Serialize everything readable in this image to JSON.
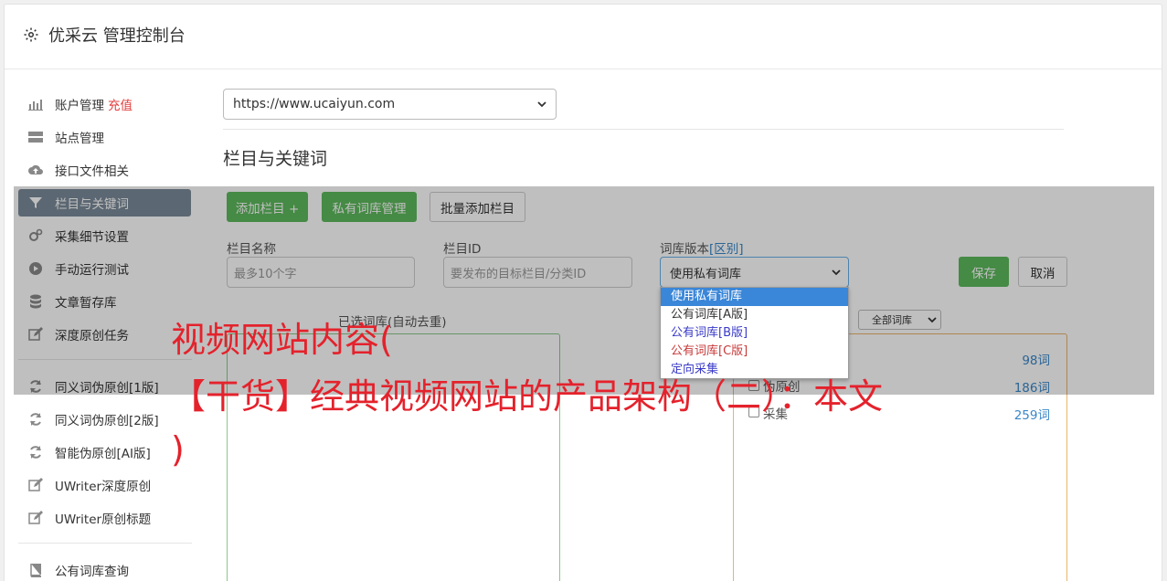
{
  "header": {
    "title": "优采云 管理控制台"
  },
  "sidebar": {
    "items": [
      {
        "label": "账户管理",
        "badge": "充值",
        "icon": "bar-chart-icon"
      },
      {
        "label": "站点管理",
        "icon": "server-icon"
      },
      {
        "label": "接口文件相关",
        "icon": "cloud-upload-icon"
      },
      {
        "label": "栏目与关键词",
        "icon": "filter-icon"
      },
      {
        "label": "采集细节设置",
        "icon": "gears-icon"
      },
      {
        "label": "手动运行测试",
        "icon": "play-circle-icon"
      },
      {
        "label": "文章暂存库",
        "icon": "database-icon"
      },
      {
        "label": "深度原创任务",
        "icon": "edit-icon"
      },
      {
        "label": "同义词伪原创[1版]",
        "icon": "refresh-icon"
      },
      {
        "label": "同义词伪原创[2版]",
        "icon": "refresh-icon"
      },
      {
        "label": "智能伪原创[AI版]",
        "icon": "refresh-icon"
      },
      {
        "label": "UWriter深度原创",
        "icon": "edit-icon"
      },
      {
        "label": "UWriter原创标题",
        "icon": "edit-icon"
      },
      {
        "label": "公有词库查询",
        "icon": "book-icon"
      }
    ]
  },
  "site_select": {
    "value": "https://www.ucaiyun.com"
  },
  "section": {
    "title": "栏目与关键词"
  },
  "toolbar": {
    "add_column": "添加栏目 +",
    "private_lib": "私有词库管理",
    "batch_add": "批量添加栏目"
  },
  "form": {
    "column_name_label": "栏目名称",
    "column_name_placeholder": "最多10个字",
    "column_id_label": "栏目ID",
    "column_id_placeholder": "要发布的目标栏目/分类ID",
    "lib_version_label": "词库版本",
    "lib_version_link": "[区别]",
    "lib_version_value": "使用私有词库",
    "save": "保存",
    "cancel": "取消"
  },
  "dropdown": {
    "options": [
      {
        "label": "使用私有词库",
        "color": "#ffffff"
      },
      {
        "label": "公有词库[A版]",
        "color": "#333333"
      },
      {
        "label": "公有词库[B版]",
        "color": "#3a3ac8"
      },
      {
        "label": "公有词库[C版]",
        "color": "#c83a3a"
      },
      {
        "label": "定向采集",
        "color": "#3a3ac8"
      }
    ]
  },
  "selected_lib": {
    "label": "已选词库(自动去重)"
  },
  "lib_filter": {
    "value": "全部词库"
  },
  "lib_list": [
    {
      "label": "",
      "count": "98词"
    },
    {
      "label": "伪原创",
      "count": "186词"
    },
    {
      "label": "采集",
      "count": "259词"
    }
  ],
  "overlay_text": {
    "line1": "视频网站内容(",
    "line2": "【干货】经典视频网站的产品架构（二）：本文",
    "line3": ")"
  }
}
